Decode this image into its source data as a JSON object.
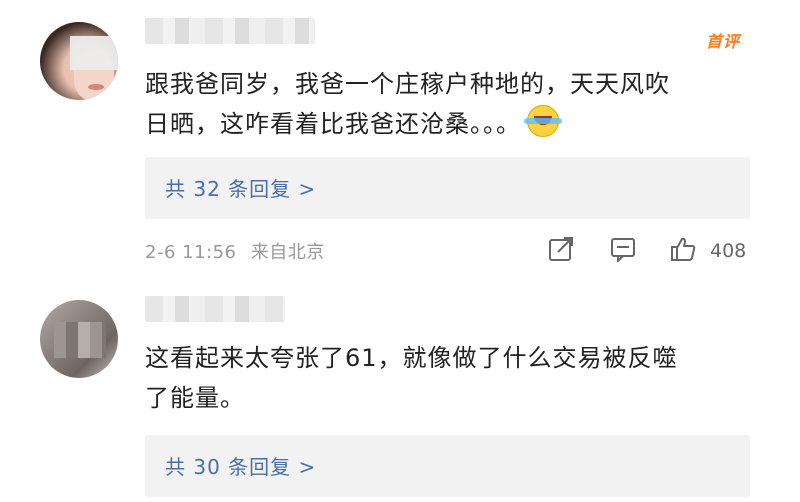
{
  "comments": [
    {
      "badge": "首评",
      "text_line1": "跟我爸同岁，我爸一个庄稼户种地的，天天风吹",
      "text_line2": "日晒，这咋看着比我爸还沧桑。。。",
      "emoji": "laughing-crying-emoji",
      "replies_label": "共 32 条回复 >",
      "timestamp": "2-6 11:56",
      "location": "来自北京",
      "likes": "408"
    },
    {
      "text_line1": "这看起来太夸张了61，就像做了什么交易被反噬",
      "text_line2": "了能量。",
      "replies_label": "共 30 条回复 >"
    }
  ],
  "icons": {
    "share": "share-icon",
    "comment": "comment-icon",
    "like": "thumbs-up-icon"
  },
  "colors": {
    "badge": "#ff7a1a",
    "link": "#4a6fa5",
    "meta": "#999999"
  }
}
